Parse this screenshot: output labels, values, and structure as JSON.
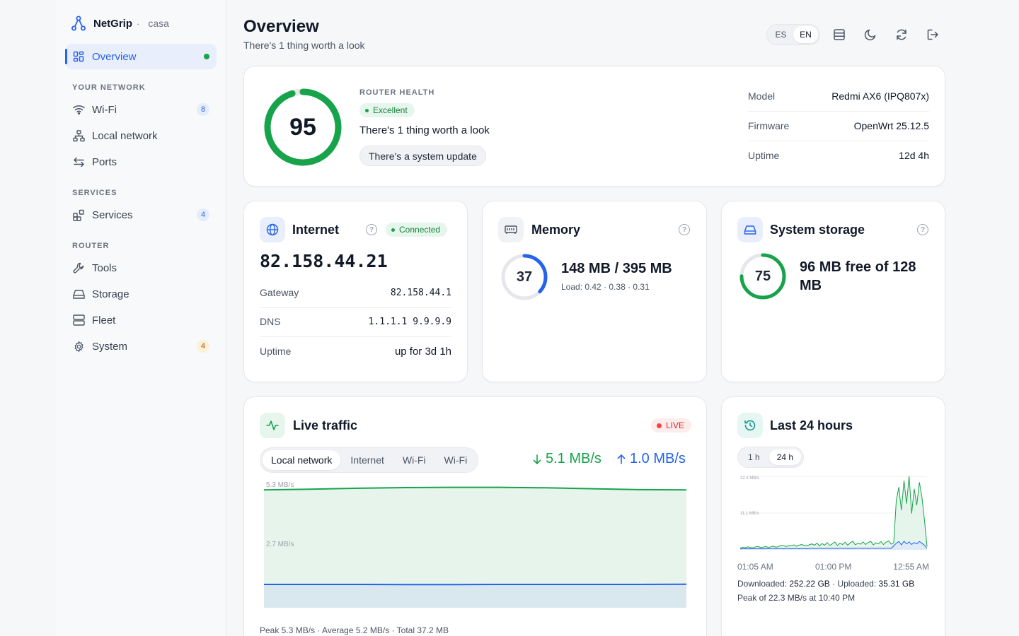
{
  "brand": {
    "name": "NetGrip",
    "separator": "·",
    "site": "casa"
  },
  "sidebar": {
    "overview": "Overview",
    "sections": [
      {
        "title": "YOUR NETWORK"
      },
      {
        "title": "SERVICES"
      },
      {
        "title": "ROUTER"
      }
    ],
    "items": [
      {
        "label": "Wi-Fi",
        "badge": "8"
      },
      {
        "label": "Local network"
      },
      {
        "label": "Ports"
      },
      {
        "label": "Services",
        "badge": "4"
      },
      {
        "label": "Tools"
      },
      {
        "label": "Storage"
      },
      {
        "label": "Fleet"
      },
      {
        "label": "System",
        "badge": "4"
      }
    ]
  },
  "header": {
    "title": "Overview",
    "subtitle": "There's 1 thing worth a look",
    "lang": [
      "ES",
      "EN"
    ],
    "active_lang": "EN"
  },
  "health": {
    "score": "95",
    "score_fraction": 0.95,
    "section_label": "ROUTER HEALTH",
    "status": "Excellent",
    "message": "There's 1 thing worth a look",
    "action": "There's a system update",
    "rows": [
      {
        "label": "Model",
        "value": "Redmi AX6 (IPQ807x)"
      },
      {
        "label": "Firmware",
        "value": "OpenWrt 25.12.5"
      },
      {
        "label": "Uptime",
        "value": "12d 4h"
      }
    ]
  },
  "internet": {
    "title": "Internet",
    "status": "Connected",
    "ip": "82.158.44.21",
    "rows": [
      {
        "label": "Gateway",
        "value": "82.158.44.1"
      },
      {
        "label": "DNS",
        "value": "1.1.1.1 9.9.9.9"
      },
      {
        "label": "Uptime",
        "value": "up for 3d 1h"
      }
    ]
  },
  "memory": {
    "title": "Memory",
    "percent": "37",
    "fraction": 0.37,
    "usage": "148 MB / 395 MB",
    "load": "Load: 0.42 · 0.38 · 0.31"
  },
  "storage": {
    "title": "System storage",
    "percent": "75",
    "fraction": 0.75,
    "usage": "96 MB free of 128 MB"
  },
  "traffic": {
    "title": "Live traffic",
    "live": "LIVE",
    "tabs": [
      "Local network",
      "Internet",
      "Wi-Fi",
      "Wi-Fi"
    ],
    "down": "5.1 MB/s",
    "up": "1.0 MB/s",
    "summary": "Peak 5.3 MB/s · Average 5.2 MB/s · Total 37.2 MB",
    "colors": {
      "down": "#16a34a",
      "up": "#2563eb"
    }
  },
  "history": {
    "title": "Last 24 hours",
    "ranges": [
      "1 h",
      "24 h"
    ],
    "active_range": "24 h",
    "x_start": "01:05 AM",
    "x_mid": "01:00 PM",
    "x_end": "12:55 AM",
    "downloaded_label": "Downloaded:",
    "downloaded": "252.22 GB",
    "uploaded_label": "Uploaded:",
    "uploaded": "35.31 GB",
    "peak": "Peak of 22.3 MB/s at 10:40 PM"
  },
  "chart_data": [
    {
      "type": "area",
      "title": "",
      "ylabel": "",
      "y_ticks": [
        "5.3 MB/s",
        "2.7 MB/s"
      ],
      "ylim": [
        0,
        5.3
      ],
      "series": [
        {
          "values": [
            5.05,
            5.08,
            5.12,
            5.15,
            5.16,
            5.16,
            5.14,
            5.1,
            5.06,
            5.05
          ]
        },
        {
          "values": [
            1.0,
            1.0,
            1.0,
            0.99,
            0.99,
            1.0,
            1.0,
            1.0,
            1.0,
            1.01
          ]
        }
      ]
    },
    {
      "type": "area",
      "title": "",
      "y_ticks": [
        "22.3 MB/s",
        "11.1 MB/s"
      ],
      "ylim": [
        0,
        22.3
      ],
      "series": [
        {
          "values": [
            0.5,
            0.8,
            0.6,
            0.9,
            0.7,
            0.6,
            0.9,
            1.0,
            0.7,
            0.8,
            1.0,
            0.7,
            0.9,
            1.1,
            0.8,
            1.0,
            1.4,
            1.2,
            1.0,
            1.3,
            1.2,
            1.5,
            1.1,
            1.4,
            1.6,
            1.3,
            1.2,
            1.5,
            1.8,
            1.4,
            2.0,
            1.2,
            1.9,
            1.4,
            2.2,
            1.3,
            1.8,
            2.4,
            1.3,
            2.0,
            1.6,
            2.3,
            1.4,
            2.1,
            2.6,
            1.5,
            2.0,
            1.7,
            2.4,
            1.6,
            2.2,
            2.6,
            1.5,
            2.1,
            1.8,
            2.5,
            1.6,
            2.3,
            2.7,
            1.7,
            2.2,
            15.0,
            19.0,
            12.0,
            21.0,
            14.0,
            22.3,
            11.0,
            18.5,
            13.5,
            20.5,
            16.0,
            9.0,
            1.0
          ]
        },
        {
          "values": [
            0.3,
            0.3,
            0.4,
            0.3,
            0.3,
            0.4,
            0.3,
            0.4,
            0.3,
            0.3,
            0.4,
            0.3,
            0.4,
            0.4,
            0.3,
            0.4,
            0.4,
            0.3,
            0.4,
            0.4,
            0.3,
            0.4,
            0.4,
            0.3,
            0.4,
            0.4,
            0.3,
            0.4,
            0.5,
            0.4,
            0.4,
            0.5,
            0.4,
            0.4,
            0.5,
            0.4,
            0.5,
            0.4,
            0.4,
            0.5,
            0.4,
            0.5,
            0.4,
            0.4,
            0.5,
            0.4,
            0.5,
            0.5,
            0.4,
            0.5,
            0.4,
            0.5,
            0.5,
            0.4,
            0.5,
            0.5,
            0.4,
            0.5,
            0.5,
            0.4,
            1.2,
            2.0,
            2.5,
            1.5,
            2.6,
            1.8,
            2.4,
            1.6,
            2.2,
            1.8,
            2.5,
            2.0,
            1.4,
            0.4
          ]
        }
      ]
    }
  ]
}
